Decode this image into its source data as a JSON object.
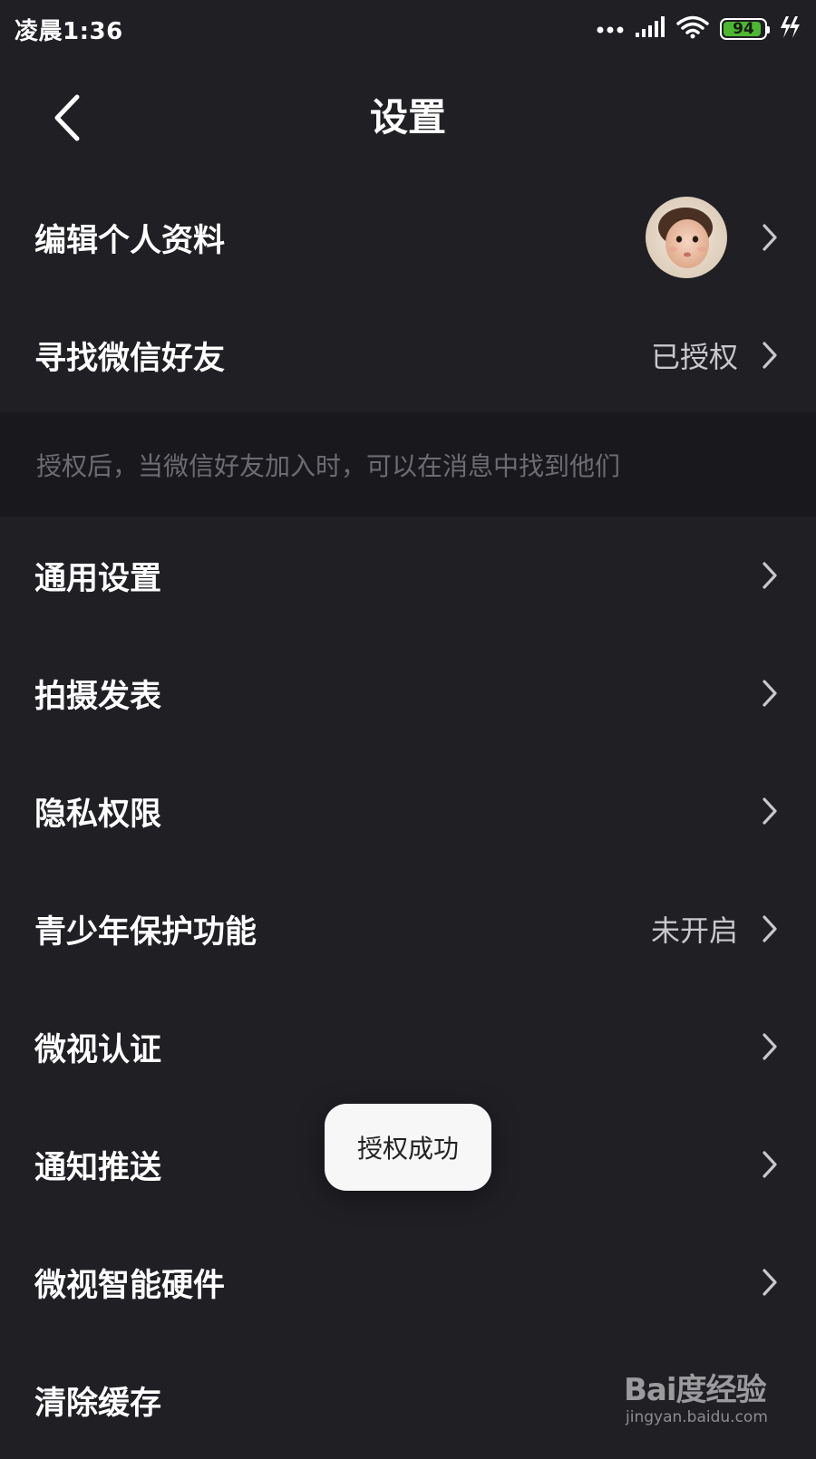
{
  "status_bar": {
    "time": "凌晨1:36",
    "battery_level": "94",
    "icons": [
      "more-dots-icon",
      "signal-icon",
      "wifi-icon",
      "battery-icon",
      "charging-icon"
    ]
  },
  "nav": {
    "title": "设置",
    "back_icon": "chevron-left-icon"
  },
  "rows": [
    {
      "label": "编辑个人资料",
      "value": "",
      "has_avatar": true
    },
    {
      "label": "寻找微信好友",
      "value": "已授权"
    },
    {
      "label": "通用设置",
      "value": ""
    },
    {
      "label": "拍摄发表",
      "value": ""
    },
    {
      "label": "隐私权限",
      "value": ""
    },
    {
      "label": "青少年保护功能",
      "value": "未开启"
    },
    {
      "label": "微视认证",
      "value": ""
    },
    {
      "label": "通知推送",
      "value": ""
    },
    {
      "label": "微视智能硬件",
      "value": ""
    },
    {
      "label": "清除缓存",
      "value": ""
    }
  ],
  "hint": "授权后，当微信好友加入时，可以在消息中找到他们",
  "toast": "授权成功",
  "watermark": {
    "logo": "Bai度经验",
    "url": "jingyan.baidu.com"
  },
  "colors": {
    "background": "#1f1f24",
    "hint_band": "#19191d",
    "battery_green": "#4cb82f",
    "secondary_text": "#c8c8cc"
  }
}
